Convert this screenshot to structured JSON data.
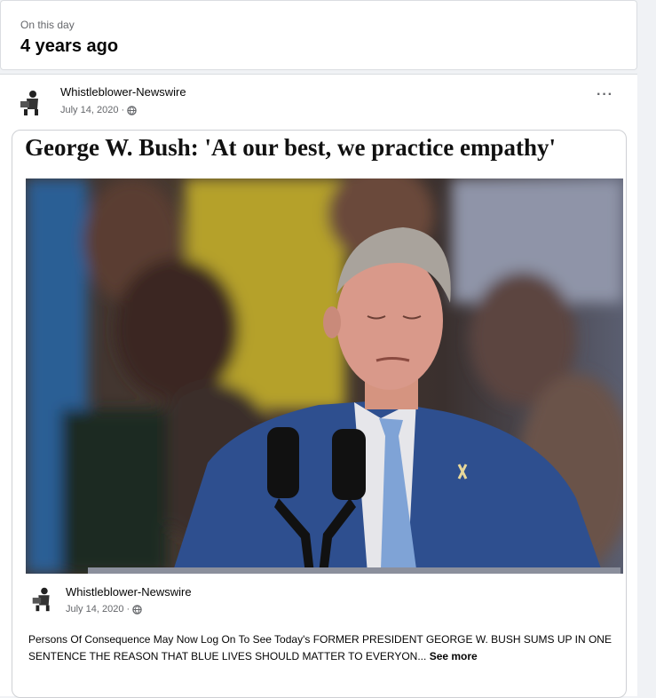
{
  "memory": {
    "kicker": "On this day",
    "title": "4 years ago"
  },
  "post": {
    "author": "Whistleblower-Newswire",
    "date": "July 14, 2020 ·",
    "privacy_icon": "globe-icon",
    "more_label": "···",
    "shared": {
      "headline": "George W. Bush: 'At our best, we practice empathy'",
      "photo_icon": "speaker-at-podium-photo",
      "author": "Whistleblower-Newswire",
      "date": "July 14, 2020 ·",
      "caption": "Persons Of Consequence May Now Log On To See Today's FORMER PRESIDENT GEORGE W. BUSH SUMS UP IN ONE SENTENCE THE REASON THAT BLUE LIVES SHOULD MATTER TO EVERYON...",
      "see_more": "See more"
    }
  },
  "colors": {
    "page_bg": "#f0f2f5",
    "card_bg": "#ffffff",
    "secondary_text": "#65676b",
    "suit": "#2e4f8f",
    "tie": "#7fa3d6"
  }
}
